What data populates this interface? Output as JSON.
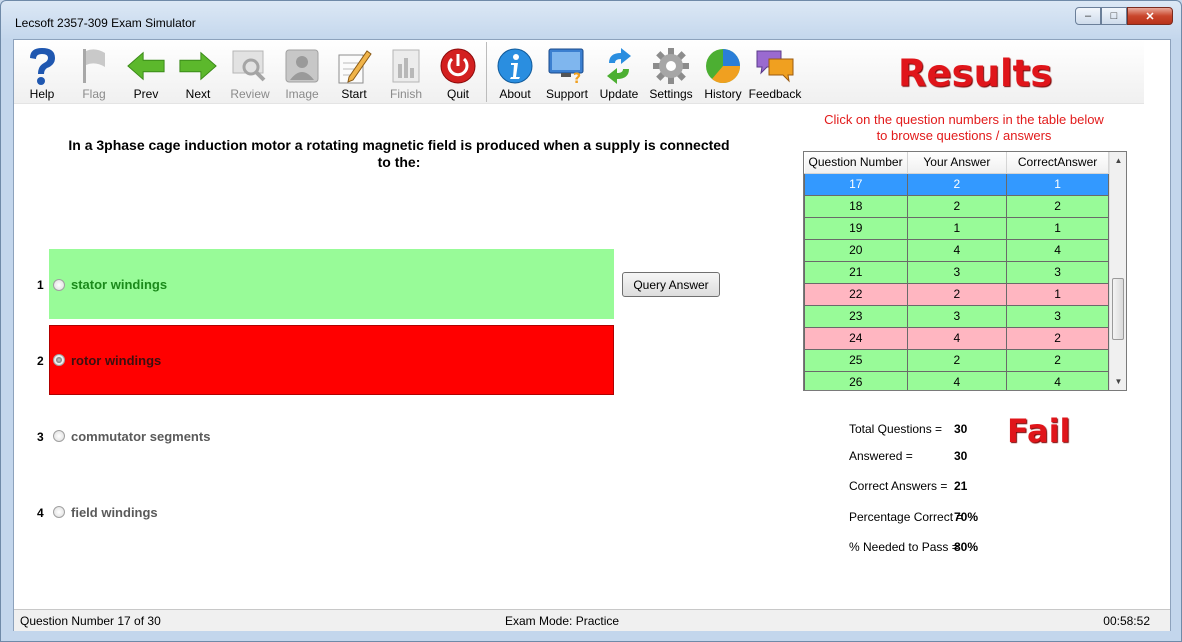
{
  "window": {
    "title": "Lecsoft 2357-309 Exam Simulator"
  },
  "toolbar": {
    "help": "Help",
    "flag": "Flag",
    "prev": "Prev",
    "next": "Next",
    "review": "Review",
    "image": "Image",
    "start": "Start",
    "finish": "Finish",
    "quit": "Quit",
    "about": "About",
    "support": "Support",
    "update": "Update",
    "settings": "Settings",
    "history": "History",
    "feedback": "Feedback"
  },
  "results": {
    "title": "Results",
    "instruction_line1": "Click on the question numbers in the table below",
    "instruction_line2": "to browse questions / answers",
    "columns": [
      "Question Number",
      "Your Answer",
      "CorrectAnswer"
    ],
    "rows": [
      {
        "q": "17",
        "yours": "2",
        "correct": "1",
        "state": "selected"
      },
      {
        "q": "18",
        "yours": "2",
        "correct": "2",
        "state": "correct"
      },
      {
        "q": "19",
        "yours": "1",
        "correct": "1",
        "state": "correct"
      },
      {
        "q": "20",
        "yours": "4",
        "correct": "4",
        "state": "correct"
      },
      {
        "q": "21",
        "yours": "3",
        "correct": "3",
        "state": "correct"
      },
      {
        "q": "22",
        "yours": "2",
        "correct": "1",
        "state": "wrong"
      },
      {
        "q": "23",
        "yours": "3",
        "correct": "3",
        "state": "correct"
      },
      {
        "q": "24",
        "yours": "4",
        "correct": "2",
        "state": "wrong"
      },
      {
        "q": "25",
        "yours": "2",
        "correct": "2",
        "state": "correct"
      },
      {
        "q": "26",
        "yours": "4",
        "correct": "4",
        "state": "correct"
      }
    ],
    "stats": {
      "total_label": "Total Questions =",
      "total_value": "30",
      "answered_label": "Answered =",
      "answered_value": "30",
      "correct_label": "Correct Answers =",
      "correct_value": "21",
      "percent_label": "Percentage Correct =",
      "percent_value": "70%",
      "needed_label": "% Needed to Pass =",
      "needed_value": "80%"
    },
    "verdict": "Fail"
  },
  "question": {
    "line1": "In a 3phase cage induction motor a rotating magnetic field is produced when a supply is connected",
    "line2": "to the:",
    "options": [
      {
        "num": "1",
        "text": "stator windings"
      },
      {
        "num": "2",
        "text": "rotor windings"
      },
      {
        "num": "3",
        "text": "commutator segments"
      },
      {
        "num": "4",
        "text": "field windings"
      }
    ],
    "query_button": "Query Answer"
  },
  "status": {
    "question_number": "Question Number 17 of 30",
    "mode": "Exam Mode: Practice",
    "timer": "00:58:52"
  },
  "colors": {
    "correct": "#98fb98",
    "wrong": "#ff0000",
    "wrong_row": "#ffb6c1",
    "selected": "#3399ff",
    "accent_red": "#e0151a"
  }
}
